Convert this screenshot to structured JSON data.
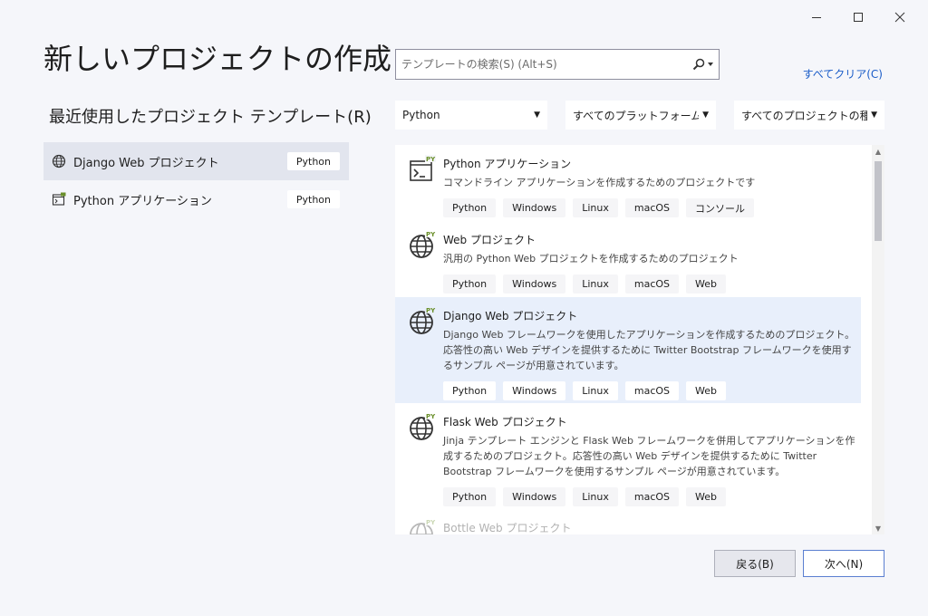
{
  "window": {
    "minimize_icon": "minimize-icon",
    "maximize_icon": "maximize-icon",
    "close_icon": "close-icon"
  },
  "title": "新しいプロジェクトの作成",
  "recent": {
    "title": "最近使用したプロジェクト テンプレート(R)",
    "items": [
      {
        "label": "Django Web プロジェクト",
        "tag": "Python",
        "icon": "globe-icon",
        "selected": true
      },
      {
        "label": "Python アプリケーション",
        "tag": "Python",
        "icon": "python-app-icon",
        "selected": false
      }
    ]
  },
  "search": {
    "placeholder": "テンプレートの検索(S) (Alt+S)",
    "icon": "search-icon"
  },
  "clear_all": "すべてクリア(C)",
  "filters": {
    "language": "Python",
    "platform": "すべてのプラットフォーム(P)",
    "project_type": "すべてのプロジェクトの種類..."
  },
  "templates": [
    {
      "name": "Python アプリケーション",
      "desc": "コマンドライン アプリケーションを作成するためのプロジェクトです",
      "tags": [
        "Python",
        "Windows",
        "Linux",
        "macOS",
        "コンソール"
      ],
      "icon": "python-app-icon"
    },
    {
      "name": "Web プロジェクト",
      "desc": "汎用の Python Web プロジェクトを作成するためのプロジェクト",
      "tags": [
        "Python",
        "Windows",
        "Linux",
        "macOS",
        "Web"
      ],
      "icon": "globe-py-icon"
    },
    {
      "name": "Django Web プロジェクト",
      "desc": "Django Web フレームワークを使用したアプリケーションを作成するためのプロジェクト。応答性の高い Web デザインを提供するために Twitter Bootstrap フレームワークを使用するサンプル ページが用意されています。",
      "tags": [
        "Python",
        "Windows",
        "Linux",
        "macOS",
        "Web"
      ],
      "icon": "globe-py-icon"
    },
    {
      "name": "Flask Web プロジェクト",
      "desc": "Jinja テンプレート エンジンと Flask Web フレームワークを併用してアプリケーションを作成するためのプロジェクト。応答性の高い Web デザインを提供するために Twitter Bootstrap フレームワークを使用するサンプル ページが用意されています。",
      "tags": [
        "Python",
        "Windows",
        "Linux",
        "macOS",
        "Web"
      ],
      "icon": "globe-py-icon"
    },
    {
      "name": "Bottle Web プロジェクト",
      "icon": "globe-py-icon"
    }
  ],
  "buttons": {
    "back": "戻る(B)",
    "next": "次へ(N)"
  },
  "colors": {
    "accent_link": "#1a5cc8",
    "selected_bg": "#e8effb",
    "primary_border": "#5b7fd1"
  }
}
